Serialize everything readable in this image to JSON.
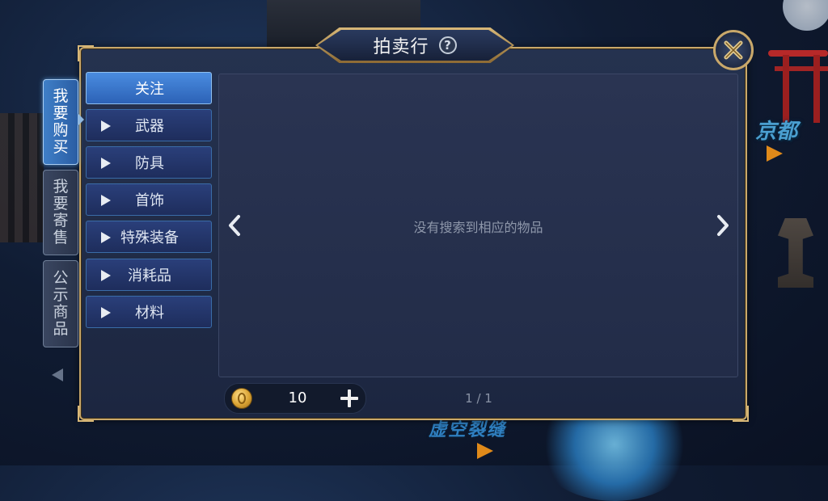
{
  "title": "拍卖行",
  "help_icon_glyph": "?",
  "side_tabs": [
    {
      "label": [
        "我",
        "要",
        "购",
        "买"
      ],
      "active": true
    },
    {
      "label": [
        "我",
        "要",
        "寄",
        "售"
      ],
      "active": false
    },
    {
      "label": [
        "公",
        "示",
        "商",
        "品"
      ],
      "active": false
    }
  ],
  "categories": [
    {
      "label": "关注",
      "active": true,
      "has_arrow": false
    },
    {
      "label": "武器",
      "active": false,
      "has_arrow": true
    },
    {
      "label": "防具",
      "active": false,
      "has_arrow": true
    },
    {
      "label": "首饰",
      "active": false,
      "has_arrow": true
    },
    {
      "label": "特殊装备",
      "active": false,
      "has_arrow": true
    },
    {
      "label": "消耗品",
      "active": false,
      "has_arrow": true
    },
    {
      "label": "材料",
      "active": false,
      "has_arrow": true
    }
  ],
  "empty_message": "没有搜索到相应的物品",
  "currency": {
    "amount": "10",
    "icon": "gold-coin-icon"
  },
  "pagination": "1 / 1",
  "background": {
    "location_label": "京都",
    "banner_text": "虚空裂缝"
  },
  "colors": {
    "accent_gold": "#c9a86a",
    "active_blue": "#2c62b6"
  }
}
